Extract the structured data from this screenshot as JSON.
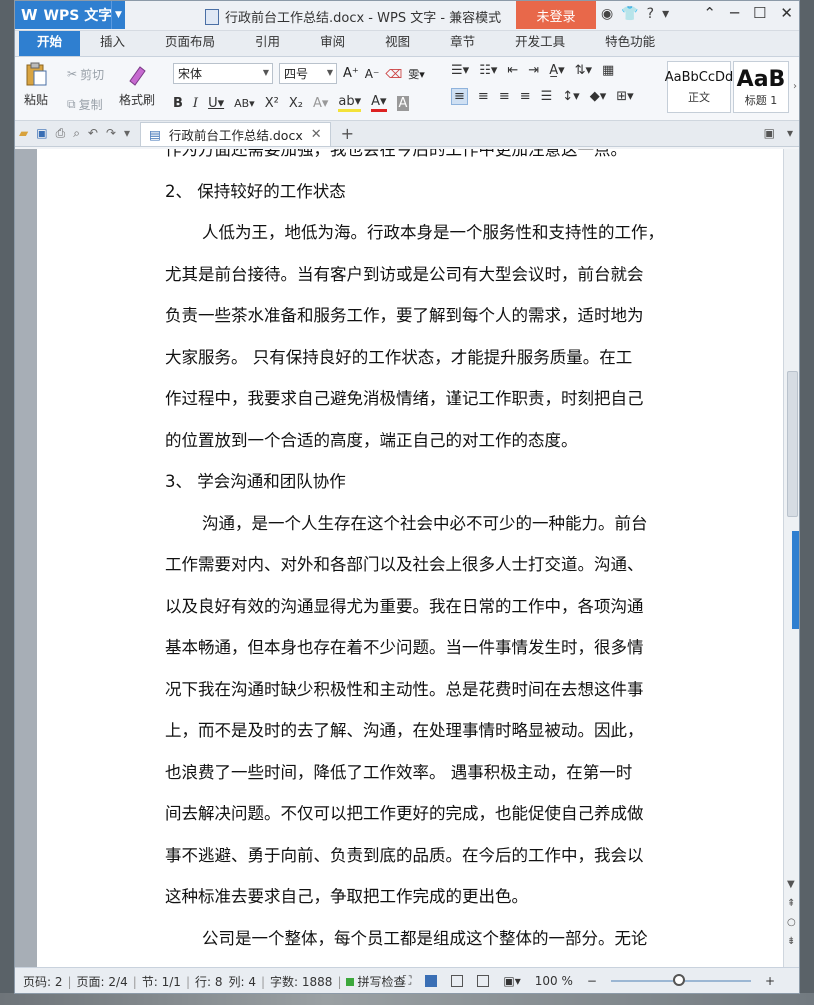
{
  "app": {
    "brand": "WPS 文字",
    "window_title": "行政前台工作总结.docx - WPS 文字 - 兼容模式",
    "login_label": "未登录",
    "accent_color": "#2f7fd0",
    "login_color": "#e8684a"
  },
  "ribbon": {
    "tabs": [
      "开始",
      "插入",
      "页面布局",
      "引用",
      "审阅",
      "视图",
      "章节",
      "开发工具",
      "特色功能"
    ],
    "active_tab": "开始"
  },
  "toolbar": {
    "paste_label": "粘贴",
    "cut_label": "剪切",
    "copy_label": "复制",
    "format_painter_label": "格式刷",
    "font_name": "宋体",
    "font_size": "四号",
    "styles": [
      {
        "preview": "AaBbCcDd",
        "name": "正文"
      },
      {
        "preview": "AaB",
        "name": "标题 1"
      }
    ]
  },
  "doc_tab": {
    "filename": "行政前台工作总结.docx"
  },
  "document": {
    "lines": [
      {
        "text": "作为方面还需要加强，我也会在今后的工作中更加注意这一点。",
        "indent": false
      },
      {
        "text": "2、    保持较好的工作状态",
        "indent": false
      },
      {
        "text": "人低为王，地低为海。行政本身是一个服务性和支持性的工作，",
        "indent": true
      },
      {
        "text": "尤其是前台接待。当有客户到访或是公司有大型会议时，前台就会",
        "indent": false
      },
      {
        "text": "负责一些茶水准备和服务工作，要了解到每个人的需求，适时地为",
        "indent": false
      },
      {
        "text": "大家服务。   只有保持良好的工作状态，才能提升服务质量。在工",
        "indent": false
      },
      {
        "text": "作过程中，我要求自己避免消极情绪，谨记工作职责，时刻把自己",
        "indent": false
      },
      {
        "text": "的位置放到一个合适的高度，端正自己的对工作的态度。",
        "indent": false
      },
      {
        "text": "3、    学会沟通和团队协作",
        "indent": false
      },
      {
        "text": "沟通，是一个人生存在这个社会中必不可少的一种能力。前台",
        "indent": true
      },
      {
        "text": "工作需要对内、对外和各部门以及社会上很多人士打交道。沟通、",
        "indent": false
      },
      {
        "text": "以及良好有效的沟通显得尤为重要。我在日常的工作中，各项沟通",
        "indent": false
      },
      {
        "text": "基本畅通，但本身也存在着不少问题。当一件事情发生时，很多情",
        "indent": false
      },
      {
        "text": "况下我在沟通时缺少积极性和主动性。总是花费时间在去想这件事",
        "indent": false
      },
      {
        "text": "上，而不是及时的去了解、沟通，在处理事情时略显被动。因此，",
        "indent": false
      },
      {
        "text": "也浪费了一些时间，降低了工作效率。   遇事积极主动，在第一时",
        "indent": false
      },
      {
        "text": "间去解决问题。不仅可以把工作更好的完成，也能促使自己养成做",
        "indent": false
      },
      {
        "text": "事不逃避、勇于向前、负责到底的品质。在今后的工作中，我会以",
        "indent": false
      },
      {
        "text": "这种标准去要求自己，争取把工作完成的更出色。",
        "indent": false
      },
      {
        "text": "公司是一个整体，每个员工都是组成这个整体的一部分。无论",
        "indent": true
      }
    ]
  },
  "status": {
    "page_code": "页码: 2",
    "pages": "页面: 2/4",
    "section": "节: 1/1",
    "row": "行: 8",
    "column": "列: 4",
    "word_count": "字数: 1888",
    "spell_check": "拼写检查",
    "zoom": "100 %"
  }
}
